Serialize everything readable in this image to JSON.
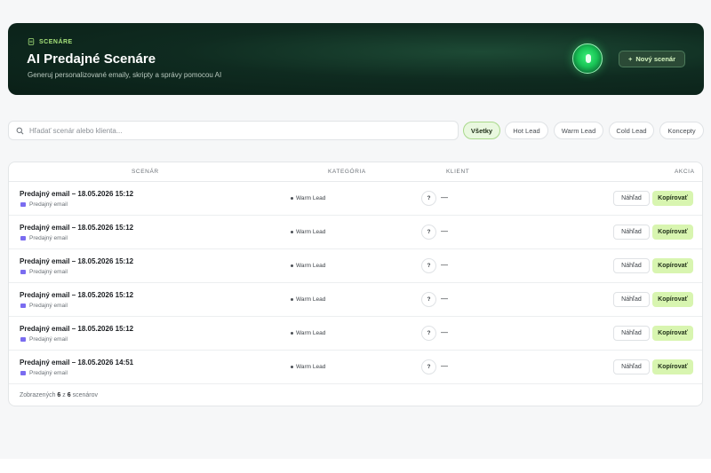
{
  "hero": {
    "tag": "SCENÁRE",
    "title": "AI Predajné Scenáre",
    "subtitle": "Generuj personalizované emaily, skripty a správy pomocou AI",
    "new_button": "Nový scenár",
    "plus_icon": "+"
  },
  "search": {
    "placeholder": "Hľadať scenár alebo klienta..."
  },
  "filters": [
    "Všetky",
    "Hot Lead",
    "Warm Lead",
    "Cold Lead",
    "Koncepty"
  ],
  "table": {
    "headers": {
      "scenario": "SCENÁR",
      "category": "KATEGÓRIA",
      "client": "KLIENT",
      "action": "AKCIA"
    },
    "rows": [
      {
        "title": "Predajný email – 18.05.2026 15:12",
        "type": "Predajný email",
        "category": "Warm Lead",
        "avatar": "?",
        "client": "—",
        "view": "Náhľad",
        "copy": "Kopírovať"
      },
      {
        "title": "Predajný email – 18.05.2026 15:12",
        "type": "Predajný email",
        "category": "Warm Lead",
        "avatar": "?",
        "client": "—",
        "view": "Náhľad",
        "copy": "Kopírovať"
      },
      {
        "title": "Predajný email – 18.05.2026 15:12",
        "type": "Predajný email",
        "category": "Warm Lead",
        "avatar": "?",
        "client": "—",
        "view": "Náhľad",
        "copy": "Kopírovať"
      },
      {
        "title": "Predajný email – 18.05.2026 15:12",
        "type": "Predajný email",
        "category": "Warm Lead",
        "avatar": "?",
        "client": "—",
        "view": "Náhľad",
        "copy": "Kopírovať"
      },
      {
        "title": "Predajný email – 18.05.2026 15:12",
        "type": "Predajný email",
        "category": "Warm Lead",
        "avatar": "?",
        "client": "—",
        "view": "Náhľad",
        "copy": "Kopírovať"
      },
      {
        "title": "Predajný email – 18.05.2026 14:51",
        "type": "Predajný email",
        "category": "Warm Lead",
        "avatar": "?",
        "client": "—",
        "view": "Náhľad",
        "copy": "Kopírovať"
      }
    ],
    "footer": {
      "prefix": "Zobrazených",
      "shown": "6",
      "middle": "z",
      "total": "6",
      "suffix": "scenárov"
    }
  },
  "colors": {
    "accent": "#a6e27a",
    "hero_bg": "#0f2b20",
    "copy_button": "#d8f5b0",
    "mail_icon": "#7a6cf0"
  }
}
